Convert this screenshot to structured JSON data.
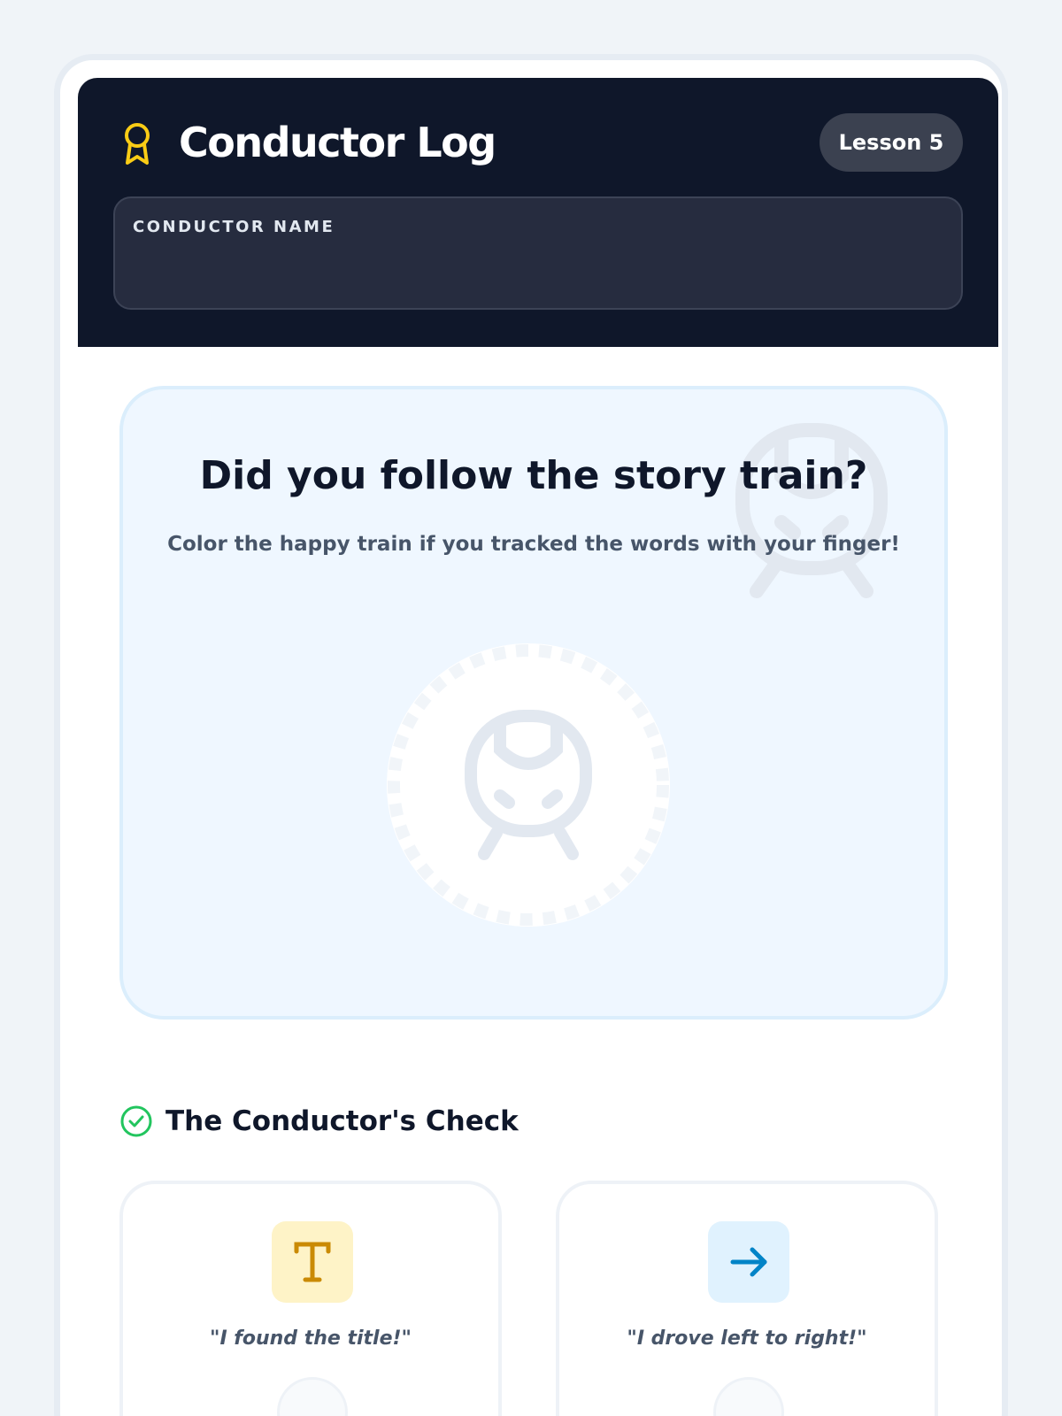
{
  "header": {
    "title": "Conductor Log",
    "lesson_badge": "Lesson 5",
    "name_field": {
      "label": "CONDUCTOR NAME",
      "value": ""
    },
    "award_icon": "award-ribbon-icon"
  },
  "question_card": {
    "title": "Did you follow the story train?",
    "subtitle": "Color the happy train if you tracked the words with your finger!",
    "watermark_icon": "train-icon",
    "coloring_target_icon": "train-icon"
  },
  "conductor_check": {
    "heading": "The Conductor's Check",
    "heading_icon": "check-circle-icon",
    "items": [
      {
        "quote": "\"I found the title!\"",
        "icon": "type-icon"
      },
      {
        "quote": "\"I drove left to right!\"",
        "icon": "arrow-right-icon"
      }
    ]
  },
  "colors": {
    "header_bg": "#0f172a",
    "accent_yellow": "#facc15",
    "check_green": "#22c55e",
    "card_bg": "#eff7ff",
    "arrow_blue": "#0284c7",
    "type_amber": "#ca8a04"
  }
}
